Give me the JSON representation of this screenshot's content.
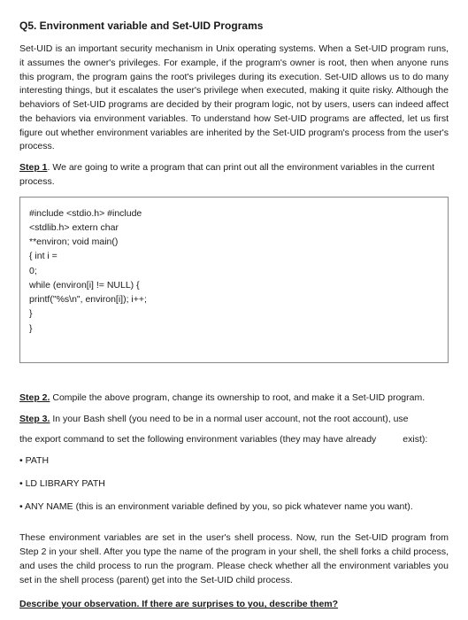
{
  "title": "Q5. Environment variable and Set-UID Programs",
  "intro": "Set-UID is an important security mechanism in Unix operating systems. When a Set-UID program runs, it assumes the owner's privileges. For example, if the program's owner is root, then when anyone runs this program, the program gains the root's privileges during its execution. Set-UID allows us to do many interesting things, but it escalates the user's privilege when executed, making it quite risky. Although the behaviors of Set-UID programs are decided by their program logic, not by users, users can indeed affect the behaviors via environment variables. To understand how Set-UID programs are affected, let us first figure out whether environment variables are inherited by the Set-UID program's process from the user's process.",
  "step1": {
    "label": "Step 1",
    "text": ". We are going to write a program that can print out all the environment variables in the current process."
  },
  "code": "#include <stdio.h> #include\n<stdlib.h> extern char\n**environ; void main()\n{ int i =\n0;\nwhile (environ[i] != NULL) {\nprintf(\"%s\\n\", environ[i]); i++;\n}\n}",
  "step2": {
    "label": "Step 2.",
    "text": " Compile the above program, change its ownership to root, and make it a Set-UID program."
  },
  "step3": {
    "label": "Step 3.",
    "text": " In your Bash shell (you need to be in a normal user account, not the root account), use"
  },
  "step3_line2": "the export command to set the following environment variables (they may have already",
  "step3_exist": "exist):",
  "bullets": {
    "b1": "• PATH",
    "b2": "• LD LIBRARY PATH",
    "b3": "• ANY NAME (this is an environment variable defined by you, so pick whatever name you want)."
  },
  "closing": "These environment variables are set in the user's shell process. Now, run the Set-UID program from Step 2 in your shell. After you type the name of the program in your shell, the shell forks a child process, and uses the child process to run the program. Please check whether all the environment variables you set in the shell process (parent) get into the Set-UID child process.",
  "question": "Describe your observation. If there are surprises to you, describe them?"
}
